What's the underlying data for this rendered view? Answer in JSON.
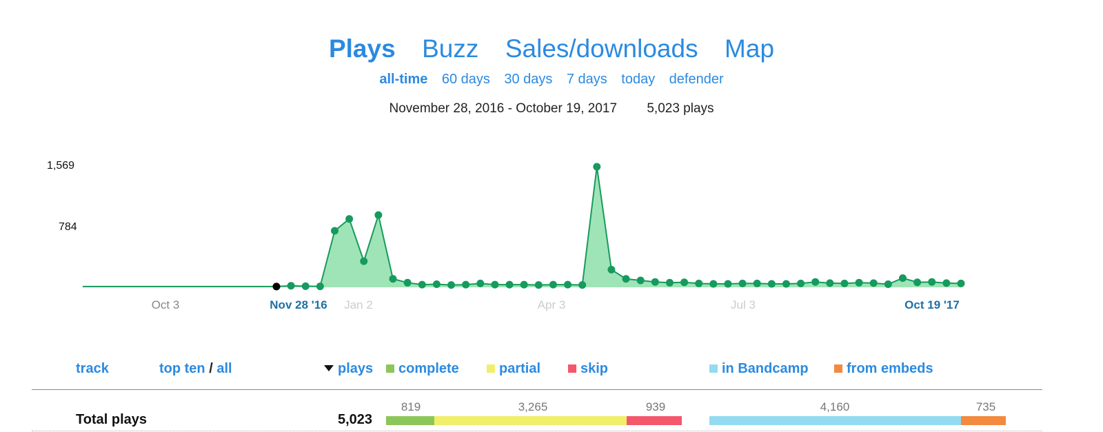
{
  "tabs": [
    {
      "label": "Plays",
      "active": true
    },
    {
      "label": "Buzz",
      "active": false
    },
    {
      "label": "Sales/downloads",
      "active": false
    },
    {
      "label": "Map",
      "active": false
    }
  ],
  "ranges": [
    {
      "label": "all-time",
      "active": true
    },
    {
      "label": "60 days",
      "active": false
    },
    {
      "label": "30 days",
      "active": false
    },
    {
      "label": "7 days",
      "active": false
    },
    {
      "label": "today",
      "active": false
    },
    {
      "label": "defender",
      "active": false
    }
  ],
  "summary": {
    "date_range": "November 28, 2016 - October 19, 2017",
    "plays": "5,023 plays"
  },
  "chart_data": {
    "type": "area",
    "x_ticks": [
      "Oct 3",
      "Nov 28 '16",
      "Jan 2",
      "Apr 3",
      "Jul 3",
      "Oct 19 '17"
    ],
    "y_ticks": [
      "1,569",
      "784"
    ],
    "ylim": [
      0,
      1569
    ],
    "colors": {
      "fill": "#9fe4b6",
      "line": "#169a5e",
      "start_point": "#000000"
    },
    "pre_period_value": 10,
    "values": [
      10,
      20,
      15,
      12,
      735,
      890,
      340,
      940,
      110,
      60,
      35,
      40,
      30,
      35,
      50,
      35,
      35,
      35,
      30,
      35,
      35,
      30,
      1569,
      230,
      110,
      90,
      70,
      60,
      65,
      50,
      45,
      45,
      50,
      50,
      45,
      45,
      50,
      70,
      55,
      50,
      60,
      55,
      40,
      120,
      65,
      70,
      55,
      50
    ]
  },
  "table": {
    "headers": {
      "track": "track",
      "top_ten": "top ten",
      "slash": "/",
      "all": "all",
      "plays": "plays",
      "complete": "complete",
      "partial": "partial",
      "skip": "skip",
      "in_bandcamp": "in Bandcamp",
      "from_embeds": "from embeds"
    },
    "legend_colors": {
      "complete": "#8cc65b",
      "partial": "#f1ef6a",
      "skip": "#f4576c",
      "in_bandcamp": "#93dbf0",
      "from_embeds": "#f38a3f"
    },
    "total": {
      "label": "Total plays",
      "plays": "5,023",
      "complete": "819",
      "partial": "3,265",
      "skip": "939",
      "in_bandcamp": "4,160",
      "from_embeds": "735",
      "values": {
        "complete": 819,
        "partial": 3265,
        "skip": 939,
        "in_bandcamp": 4160,
        "from_embeds": 735
      }
    }
  }
}
